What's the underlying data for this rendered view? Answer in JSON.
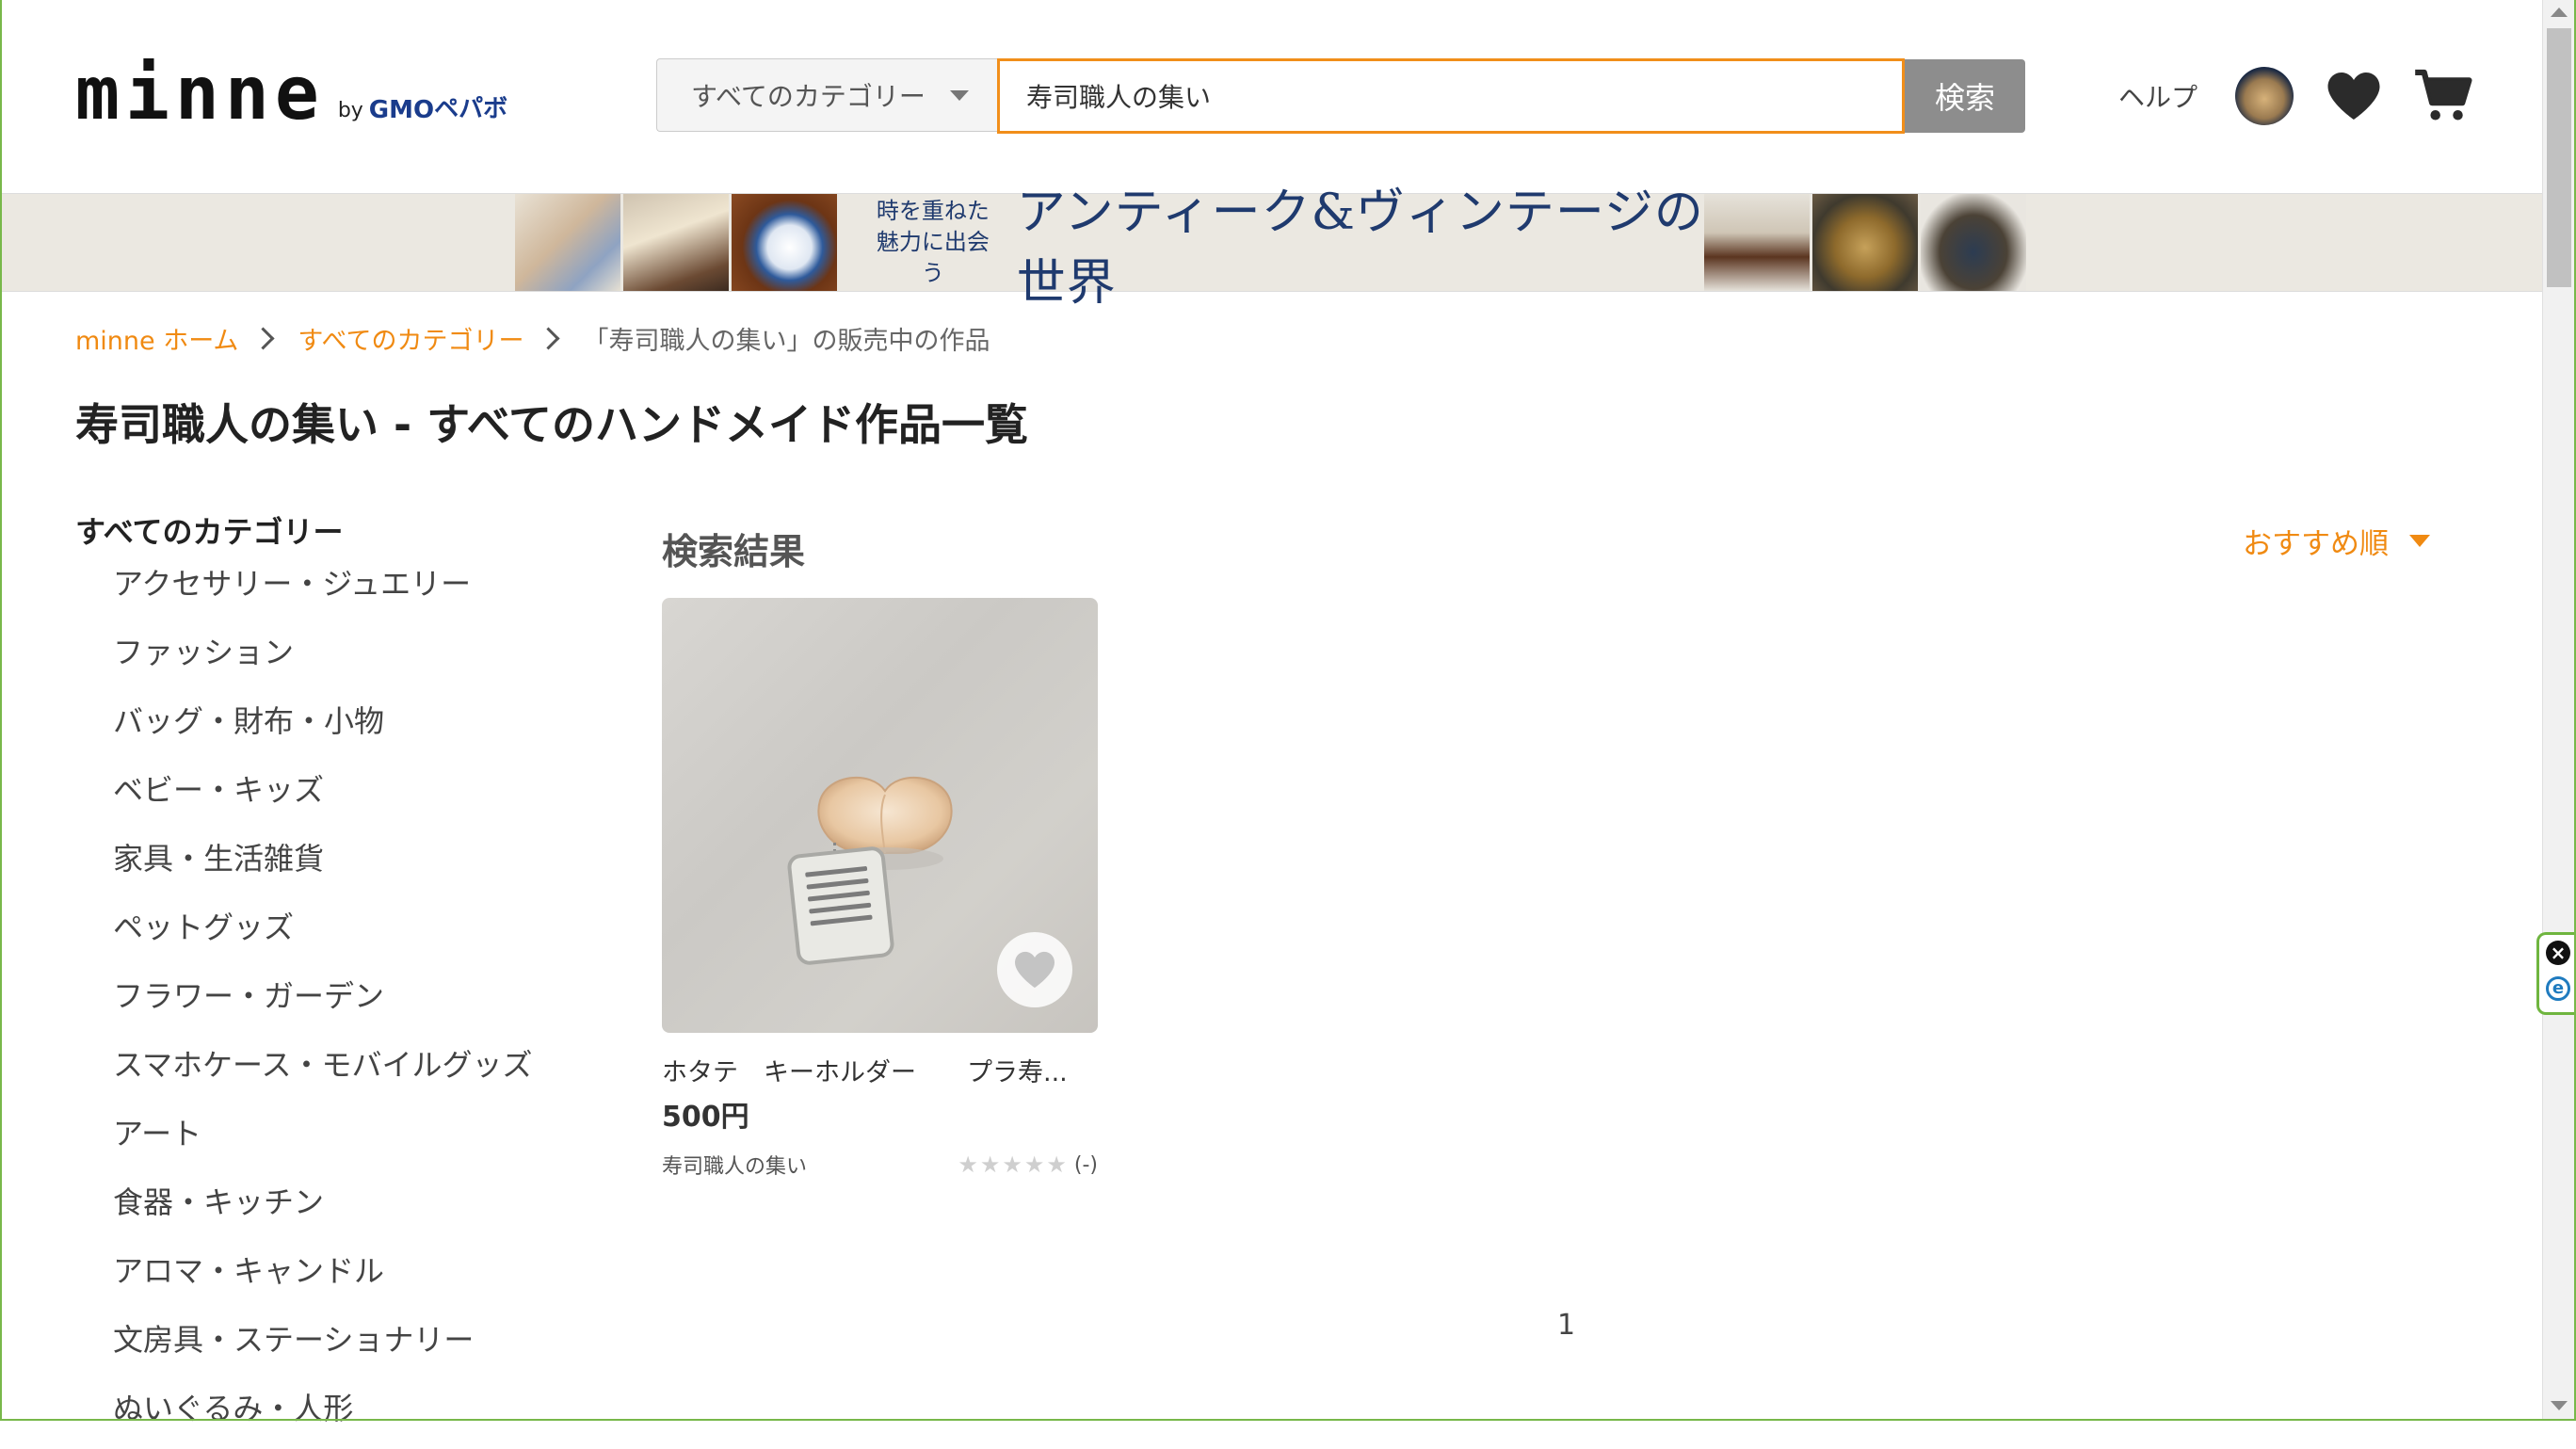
{
  "header": {
    "logo_word": "minne",
    "logo_by": "by",
    "logo_gmo": "GMO",
    "logo_pepabo": "ペパボ",
    "category_select": "すべてのカテゴリー",
    "search_value": "寿司職人の集い",
    "search_button": "検索",
    "help": "ヘルプ"
  },
  "banner": {
    "line1": "時を重ねた",
    "line2": "魅力に出会う",
    "headline": "アンティーク&ヴィンテージの世界"
  },
  "breadcrumb": {
    "home": "minne ホーム",
    "category": "すべてのカテゴリー",
    "current": "「寿司職人の集い」の販売中の作品"
  },
  "page_title": "寿司職人の集い - すべてのハンドメイド作品一覧",
  "sidebar": {
    "heading": "すべてのカテゴリー",
    "items": [
      "アクセサリー・ジュエリー",
      "ファッション",
      "バッグ・財布・小物",
      "ベビー・キッズ",
      "家具・生活雑貨",
      "ペットグッズ",
      "フラワー・ガーデン",
      "スマホケース・モバイルグッズ",
      "アート",
      "食器・キッチン",
      "アロマ・キャンドル",
      "文房具・ステーショナリー",
      "ぬいぐるみ・人形"
    ]
  },
  "results": {
    "title": "検索結果",
    "sort_label": "おすすめ順",
    "products": [
      {
        "name": "ホタテ　キーホルダー　　プラ寿...",
        "price": "500円",
        "shop": "寿司職人の集い",
        "rating_count": "(-)",
        "rating_stars": 0
      }
    ],
    "page": "1"
  },
  "colors": {
    "accent": "#f08a12",
    "search_border": "#f18e1a",
    "search_button_bg": "#8d8d8d",
    "banner_bg": "#ebe8e1",
    "window_border": "#78b84a"
  },
  "icons": {
    "avatar": "avatar",
    "favorites": "heart-icon",
    "cart": "cart-icon",
    "sort": "caret-down-icon",
    "breadcrumb_separator": "chevron-right-icon"
  }
}
